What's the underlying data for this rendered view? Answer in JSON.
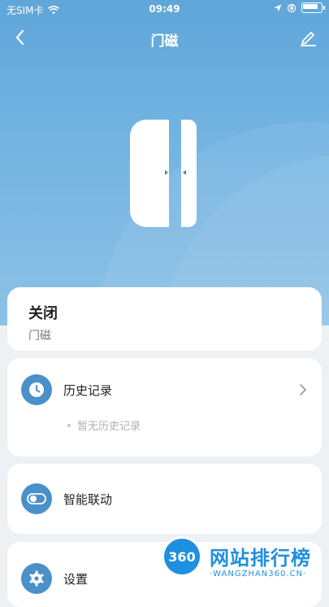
{
  "status_bar": {
    "carrier": "无SIM卡",
    "time": "09:49"
  },
  "nav": {
    "title": "门磁"
  },
  "status_card": {
    "state": "关闭",
    "device_name": "门磁"
  },
  "history": {
    "label": "历史记录",
    "empty_text": "暂无历史记录"
  },
  "smart": {
    "label": "智能联动"
  },
  "settings": {
    "label": "设置"
  },
  "watermark": {
    "logo_text": "360",
    "brand": "网站排行榜",
    "domain": "·WANGZHAN360.CN·"
  },
  "colors": {
    "hero_top": "#5fa6d9",
    "hero_bottom": "#8cc1e6",
    "icon_circle": "#4a90c9",
    "watermark_blue": "#1f8fe0"
  },
  "icons": {
    "back": "chevron-left-icon",
    "edit": "pencil-icon",
    "history": "clock-icon",
    "smart": "toggle-icon",
    "settings": "gear-icon",
    "row_arrow": "chevron-right-icon"
  }
}
